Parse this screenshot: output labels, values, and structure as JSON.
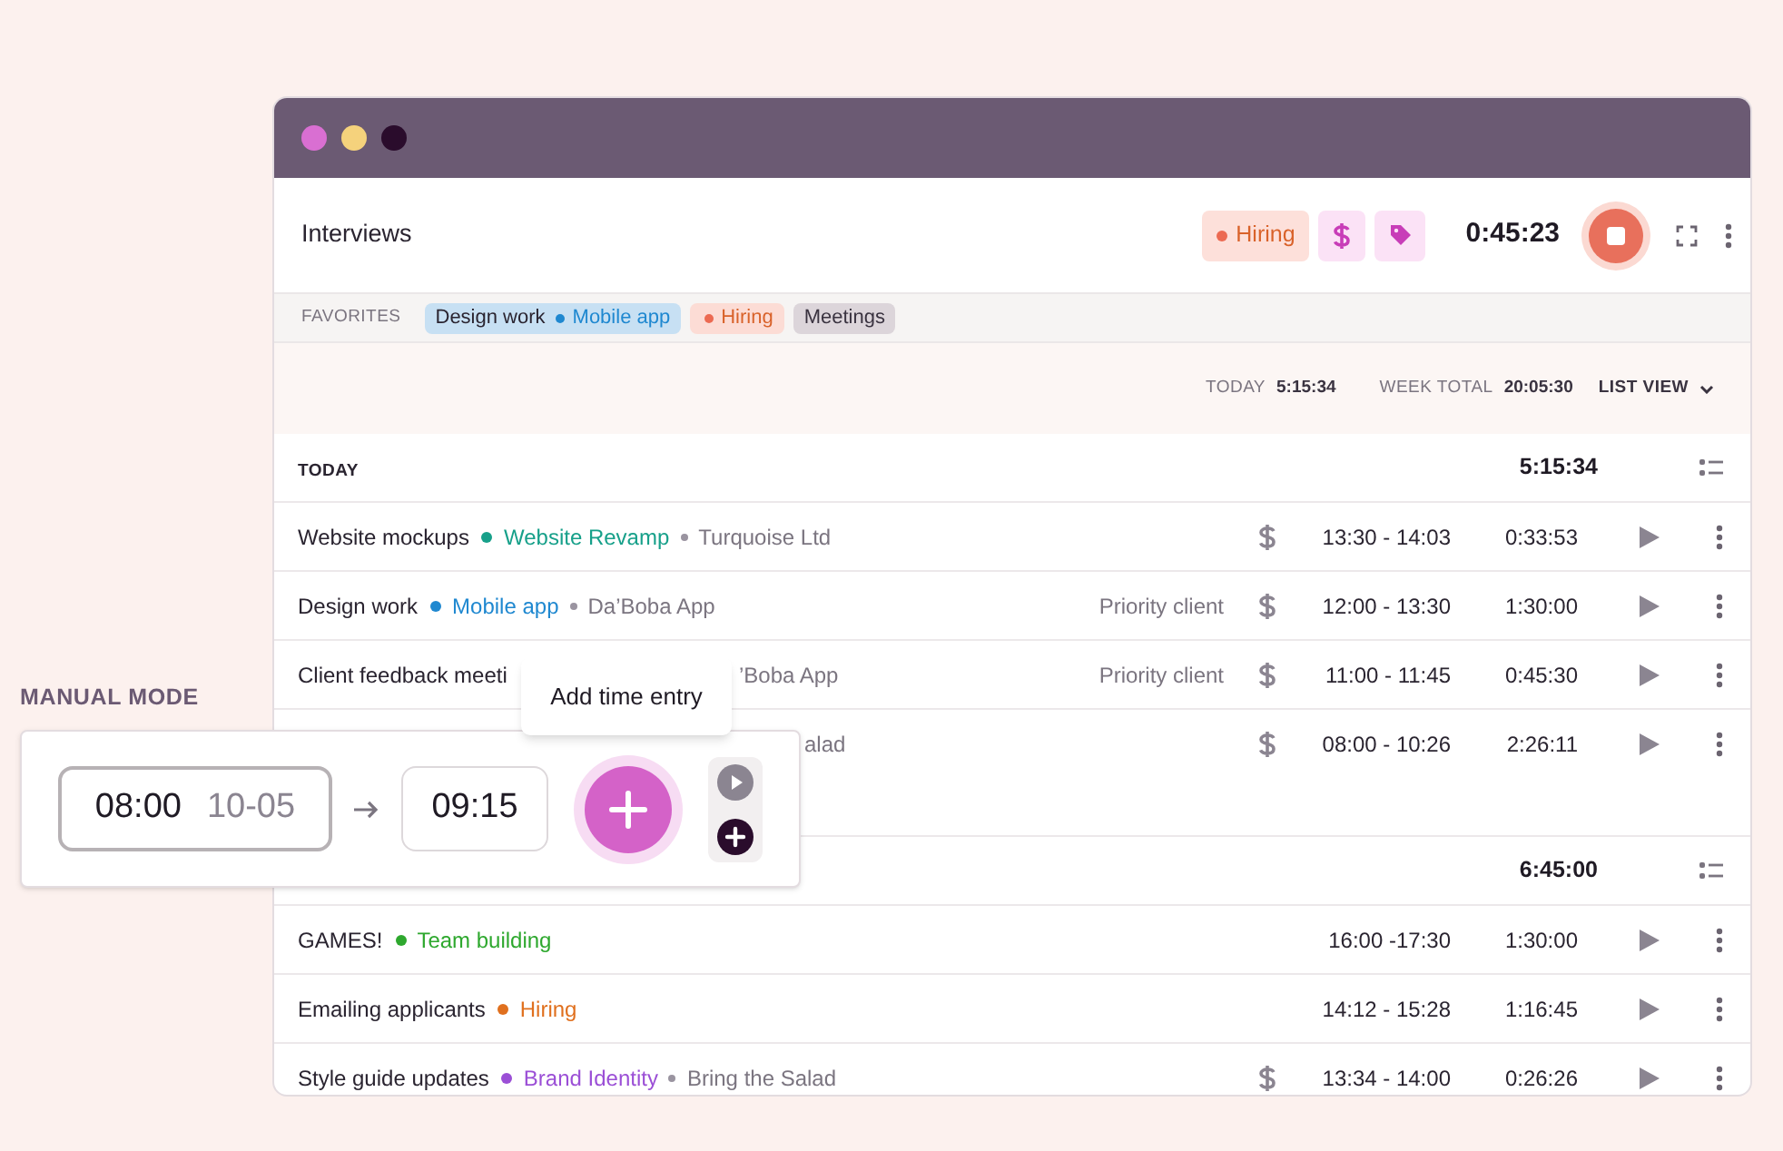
{
  "window": {
    "dots": [
      {
        "color": "#d96fd2"
      },
      {
        "color": "#f5d27c"
      },
      {
        "color": "#2a0c2c"
      }
    ]
  },
  "header": {
    "title": "Interviews",
    "tag": {
      "name": "Hiring",
      "color": "#ec6a52"
    },
    "timer": "0:45:23"
  },
  "favorites": {
    "label": "FAVORITES",
    "chips": [
      {
        "kind": "project",
        "name": "Design work",
        "project": "Mobile app",
        "color": "#1f88d0"
      },
      {
        "kind": "tag",
        "name": "Hiring",
        "color": "#ec6a52"
      },
      {
        "kind": "plain",
        "name": "Meetings"
      }
    ]
  },
  "summary": {
    "today_label": "TODAY",
    "today": "5:15:34",
    "week_label": "WEEK TOTAL",
    "week": "20:05:30",
    "view": "LIST VIEW"
  },
  "groups": [
    {
      "label": "TODAY",
      "total": "5:15:34",
      "rows": [
        {
          "kind": "full",
          "title": "Website mockups",
          "project": "Website Revamp",
          "color": "#17a08a",
          "client": "Turquoise Ltd",
          "billable": true,
          "range": "13:30 - 14:03",
          "duration": "0:33:53"
        },
        {
          "kind": "full",
          "title": "Design work",
          "project": "Mobile app",
          "color": "#1f88d0",
          "client": "Da’Boba App",
          "tag": "Priority client",
          "billable": true,
          "range": "12:00 - 13:30",
          "duration": "1:30:00"
        },
        {
          "kind": "obscured",
          "title": "Client feedback meeti",
          "client": "’Boba App",
          "tag": "Priority client",
          "billable": true,
          "range": "11:00 - 11:45",
          "duration": "0:45:30"
        },
        {
          "kind": "hidden",
          "client": "alad",
          "billable": true,
          "range": "08:00 - 10:26",
          "duration": "2:26:11"
        }
      ]
    },
    {
      "total": "6:45:00",
      "rows": [
        {
          "kind": "full",
          "title": "GAMES!",
          "project": "Team building",
          "color": "#2ea82e",
          "billable": false,
          "range": "16:00 -17:30",
          "duration": "1:30:00"
        },
        {
          "kind": "full",
          "title": "Emailing applicants",
          "project": "Hiring",
          "color": "#e0701e",
          "billable": false,
          "range": "14:12 - 15:28",
          "duration": "1:16:45"
        },
        {
          "kind": "full",
          "title": "Style guide updates",
          "project": "Brand Identity",
          "color": "#9b4fd6",
          "client": "Bring the Salad",
          "billable": true,
          "range": "13:34 - 14:00",
          "duration": "0:26:26"
        }
      ]
    }
  ],
  "manual": {
    "label": "MANUAL MODE",
    "start": "08:00",
    "date": "10-05",
    "end": "09:15",
    "modes": [
      {
        "kind": "timer",
        "selected": false
      },
      {
        "kind": "manual",
        "selected": true
      }
    ],
    "tooltip": "Add time entry"
  }
}
